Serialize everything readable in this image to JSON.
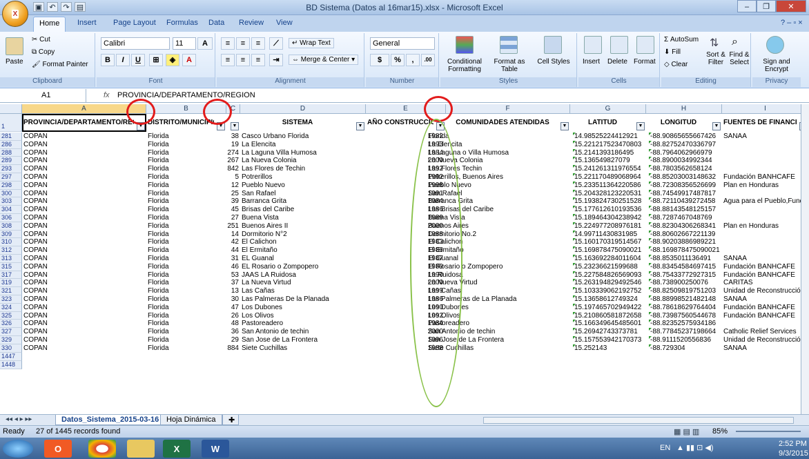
{
  "window": {
    "title": "BD Sistema (Datos al 16mar15).xlsx - Microsoft Excel",
    "office_button_label": "X"
  },
  "qat": [
    "save-icon",
    "undo-icon",
    "redo-icon",
    "print-icon"
  ],
  "tabs": [
    "Home",
    "Insert",
    "Page Layout",
    "Formulas",
    "Data",
    "Review",
    "View"
  ],
  "ribbon": {
    "clipboard": {
      "paste": "Paste",
      "cut": "Cut",
      "copy": "Copy",
      "format_painter": "Format Painter",
      "label": "Clipboard"
    },
    "font": {
      "name": "Calibri",
      "size": "11",
      "label": "Font"
    },
    "alignment": {
      "wrap": "Wrap Text",
      "merge": "Merge & Center",
      "label": "Alignment"
    },
    "number": {
      "format": "General",
      "label": "Number"
    },
    "styles": {
      "cond": "Conditional Formatting",
      "table": "Format as Table",
      "cell": "Cell Styles",
      "label": "Styles"
    },
    "cells": {
      "insert": "Insert",
      "delete": "Delete",
      "format": "Format",
      "label": "Cells"
    },
    "editing": {
      "autosum": "AutoSum",
      "fill": "Fill",
      "clear": "Clear",
      "sort": "Sort & Filter",
      "find": "Find & Select",
      "label": "Editing"
    },
    "privacy": {
      "sign": "Sign and Encrypt",
      "label": "Privacy"
    }
  },
  "formula_bar": {
    "name_box": "A1",
    "fx": "fx",
    "value": "PROVINCIA/DEPARTAMENTO/REGION"
  },
  "column_letters": [
    "A",
    "B",
    "C",
    "D",
    "E",
    "F",
    "G",
    "H",
    "I"
  ],
  "headers": [
    "PROVINCIA/DEPARTAMENTO/REGION",
    "DISTRITO/MUNICIPIO",
    "ID",
    "SISTEMA",
    "AÑO CONSTRUCCION",
    "COMUNIDADES ATENDIDAS",
    "LATITUD",
    "LONGITUD",
    "FUENTES DE FINANCIAMIENTO"
  ],
  "header_row_num": "1",
  "rows": [
    {
      "n": "281",
      "prov": "COPAN",
      "dist": "Florida",
      "id": "38",
      "sis": "Casco Urbano Florida",
      "year": "1982",
      "com": "Florida",
      "lat": "14.98525224412921",
      "lon": "-88.90865655667426",
      "fuente": "SANAA"
    },
    {
      "n": "286",
      "prov": "COPAN",
      "dist": "Florida",
      "id": "19",
      "sis": "La Elencita",
      "year": "1993",
      "com": "La Elencita",
      "lat": "15.221217523470803",
      "lon": "-88.82752470336797",
      "fuente": ""
    },
    {
      "n": "288",
      "prov": "COPAN",
      "dist": "Florida",
      "id": "274",
      "sis": "La Laguna Villa Humosa",
      "year": "1984",
      "com": "La Laguna o Villa Humosa",
      "lat": "15.2141393186495",
      "lon": "-88.7964062966979",
      "fuente": ""
    },
    {
      "n": "289",
      "prov": "COPAN",
      "dist": "Florida",
      "id": "267",
      "sis": "La Nueva Colonia",
      "year": "2000",
      "com": "La Nueva Colonia",
      "lat": "15.136549827079",
      "lon": "-88.8900034992344",
      "fuente": ""
    },
    {
      "n": "293",
      "prov": "COPAN",
      "dist": "Florida",
      "id": "842",
      "sis": "Las Flores de Techin",
      "year": "1992",
      "com": "Las Flores Techin",
      "lat": "15.241261311976554",
      "lon": "-88.7803562658124",
      "fuente": ""
    },
    {
      "n": "297",
      "prov": "COPAN",
      "dist": "Florida",
      "id": "5",
      "sis": "Potrerillos",
      "year": "1992",
      "com": "Potrerillos, Buenos Aires",
      "lat": "15.221170489068964",
      "lon": "-88.85203003148632",
      "fuente": "Fundación BANHCAFE"
    },
    {
      "n": "298",
      "prov": "COPAN",
      "dist": "Florida",
      "id": "12",
      "sis": "Pueblo Nuevo",
      "year": "1998",
      "com": "Pueblo Nuevo",
      "lat": "15.233511364220586",
      "lon": "-88.72308356526699",
      "fuente": "Plan en Honduras"
    },
    {
      "n": "300",
      "prov": "COPAN",
      "dist": "Florida",
      "id": "25",
      "sis": "San Rafael",
      "year": "1991",
      "com": "San Rafael",
      "lat": "15.204328123220531",
      "lon": "-88.74549917487817",
      "fuente": ""
    },
    {
      "n": "303",
      "prov": "COPAN",
      "dist": "Florida",
      "id": "39",
      "sis": "Barranca Grita",
      "year": "1984",
      "com": "Barranca Grita",
      "lat": "15.193824730251528",
      "lon": "-88.72110439272458",
      "fuente": "Agua para el Pueblo,Fund"
    },
    {
      "n": "304",
      "prov": "COPAN",
      "dist": "Florida",
      "id": "45",
      "sis": "Brisas del Caribe",
      "year": "1986",
      "com": "Las Brisas del Caribe",
      "lat": "15.177612610193536",
      "lon": "-88.88143548125157",
      "fuente": ""
    },
    {
      "n": "306",
      "prov": "COPAN",
      "dist": "Florida",
      "id": "27",
      "sis": "Buena Vista",
      "year": "1989",
      "com": "Buena Vista",
      "lat": "15.189464304238942",
      "lon": "-88.7287467048769",
      "fuente": ""
    },
    {
      "n": "308",
      "prov": "COPAN",
      "dist": "Florida",
      "id": "251",
      "sis": "Buenos Aires II",
      "year": "2000",
      "com": "Buenos Aires",
      "lat": "15.224977208976181",
      "lon": "-88.82304306268341",
      "fuente": "Plan en Honduras"
    },
    {
      "n": "309",
      "prov": "COPAN",
      "dist": "Florida",
      "id": "14",
      "sis": "Dormitorio N°2",
      "year": "1988",
      "com": "Dormitorio No.2",
      "lat": "14.99711430831985",
      "lon": "-88.80602667221139",
      "fuente": ""
    },
    {
      "n": "310",
      "prov": "COPAN",
      "dist": "Florida",
      "id": "42",
      "sis": "El Calichon",
      "year": "1983",
      "com": "El Calichon",
      "lat": "15.160170319514567",
      "lon": "-88.90203886989221",
      "fuente": ""
    },
    {
      "n": "312",
      "prov": "COPAN",
      "dist": "Florida",
      "id": "44",
      "sis": "El Ermitaño",
      "year": "1986",
      "com": "El Ermitaño",
      "lat": "15.169878475090021",
      "lon": "-88.169878475090021",
      "fuente": ""
    },
    {
      "n": "313",
      "prov": "COPAN",
      "dist": "Florida",
      "id": "31",
      "sis": "EL Guanal",
      "year": "1987",
      "com": "El Guanal",
      "lat": "15.163692284011604",
      "lon": "-88.8535011136491",
      "fuente": "SANAA"
    },
    {
      "n": "315",
      "prov": "COPAN",
      "dist": "Florida",
      "id": "46",
      "sis": "EL Rosario o Zompopero",
      "year": "1989",
      "com": "El Rosario o Zompopero",
      "lat": "15.23236621599688",
      "lon": "-88.83454584697415",
      "fuente": "Fundación BANHCAFE"
    },
    {
      "n": "317",
      "prov": "COPAN",
      "dist": "Florida",
      "id": "53",
      "sis": "JAAS LA Ruidosa",
      "year": "1990",
      "com": "La Ruidosa",
      "lat": "15.227584826569093",
      "lon": "-88.75433772927315",
      "fuente": "Fundación BANHCAFE"
    },
    {
      "n": "319",
      "prov": "COPAN",
      "dist": "Florida",
      "id": "37",
      "sis": "La Nueva Virtud",
      "year": "2000",
      "com": "La Nueva Virtud",
      "lat": "15.263194829492546",
      "lon": "-88.738900250076",
      "fuente": "CARITAS"
    },
    {
      "n": "321",
      "prov": "COPAN",
      "dist": "Florida",
      "id": "13",
      "sis": "Las Cañas",
      "year": "1999",
      "com": "Las Cañas",
      "lat": "15.103339062192752",
      "lon": "-88.82509819751203",
      "fuente": "Unidad de Reconstrucción"
    },
    {
      "n": "323",
      "prov": "COPAN",
      "dist": "Florida",
      "id": "30",
      "sis": "Las Palmeras De la Planada",
      "year": "1986",
      "com": "Las Palmeras de La Planada",
      "lat": "15.13658612749324",
      "lon": "-88.88998521482148",
      "fuente": "SANAA"
    },
    {
      "n": "324",
      "prov": "COPAN",
      "dist": "Florida",
      "id": "47",
      "sis": "Los Dubones",
      "year": "1990",
      "com": "Los Dubones",
      "lat": "15.197465702949422",
      "lon": "-88.78618629764404",
      "fuente": "Fundación BANHCAFE"
    },
    {
      "n": "325",
      "prov": "COPAN",
      "dist": "Florida",
      "id": "26",
      "sis": "Los Olivos",
      "year": "1992",
      "com": "Los Olivos",
      "lat": "15.210860581872658",
      "lon": "-88.73987560544678",
      "fuente": "Fundación BANHCAFE"
    },
    {
      "n": "326",
      "prov": "COPAN",
      "dist": "Florida",
      "id": "48",
      "sis": "Pastoreadero",
      "year": "1984",
      "com": "Pastoreadero",
      "lat": "15.166349645485601",
      "lon": "-88.82352575934186",
      "fuente": ""
    },
    {
      "n": "327",
      "prov": "COPAN",
      "dist": "Florida",
      "id": "36",
      "sis": "San Antonio de techin",
      "year": "2000",
      "com": "San Antonio de techin",
      "lat": "15.26942743373781",
      "lon": "-88.77845237198664",
      "fuente": "Catholic Relief Services"
    },
    {
      "n": "329",
      "prov": "COPAN",
      "dist": "Florida",
      "id": "29",
      "sis": "San Jose de La Frontera",
      "year": "1996",
      "com": "San Jose de La Frontera",
      "lat": "15.157553942170373",
      "lon": "-88.9111520556836",
      "fuente": "Unidad de Reconstrucción"
    },
    {
      "n": "330",
      "prov": "COPAN",
      "dist": "Florida",
      "id": "884",
      "sis": "Siete Cuchillas",
      "year": "1988",
      "com": "Siete Cuchillas",
      "lat": "15.252143",
      "lon": "-88.729304",
      "fuente": "SANAA"
    }
  ],
  "extra_rows": [
    "1447",
    "1448"
  ],
  "sheet_tabs": [
    "Datos_Sistema_2015-03-16",
    "Hoja Dinámica"
  ],
  "status": {
    "ready": "Ready",
    "records": "27 of 1445 records found",
    "zoom": "85%"
  },
  "tray": {
    "lang": "EN",
    "time": "2:52 PM",
    "date": "9/3/2015"
  }
}
